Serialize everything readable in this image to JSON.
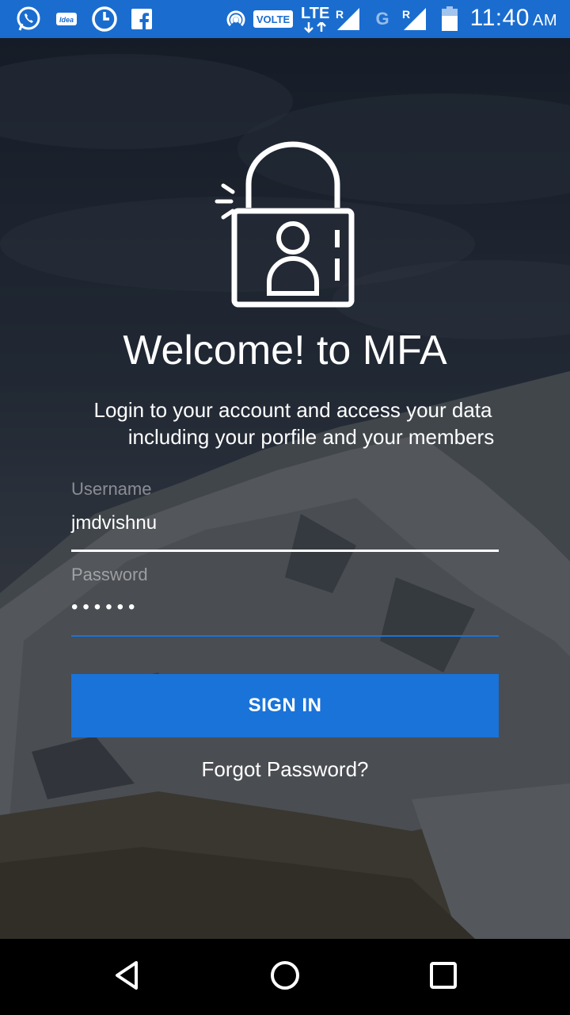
{
  "status_bar": {
    "time": "11:40",
    "ampm": "AM",
    "volte": "VOLTE",
    "lte": "LTE",
    "network_g": "G",
    "roaming_1": "R",
    "roaming_2": "R",
    "carrier_icon_text": "Idea",
    "icons": [
      "whatsapp-icon",
      "idea-icon",
      "circle-app-icon",
      "facebook-icon",
      "hotspot-icon",
      "signal-icon",
      "signal-icon",
      "battery-icon"
    ]
  },
  "login": {
    "title": "Welcome! to MFA",
    "subtitle_line1": "Login to your account and access your data",
    "subtitle_line2": "including your porfile and your members",
    "username_label": "Username",
    "username_value": "jmdvishnu",
    "password_label": "Password",
    "password_value": "••••••",
    "sign_in_label": "SIGN IN",
    "forgot_label": "Forgot Password?"
  },
  "colors": {
    "status_bar": "#1a6dcf",
    "button": "#1a73d8",
    "focused_underline": "#1a73d8",
    "nav_bar": "#000000"
  },
  "nav_bar": {
    "icons": [
      "back-icon",
      "home-icon",
      "recents-icon"
    ]
  }
}
